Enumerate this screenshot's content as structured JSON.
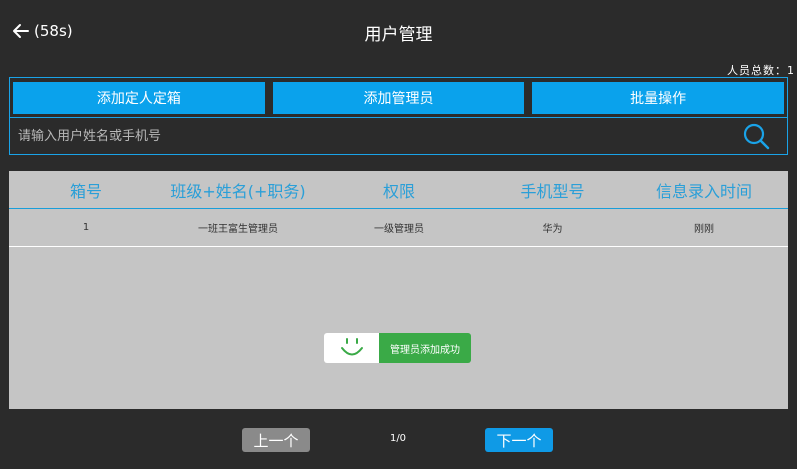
{
  "header": {
    "back_timer": "(58s)",
    "title": "用户管理",
    "total_count": "人员总数：1"
  },
  "actions": {
    "add_box_user": "添加定人定箱",
    "add_admin": "添加管理员",
    "batch_ops": "批量操作"
  },
  "search": {
    "placeholder": "请输入用户姓名或手机号",
    "value": ""
  },
  "table": {
    "columns": [
      "箱号",
      "班级+姓名(+职务)",
      "权限",
      "手机型号",
      "信息录入时间"
    ],
    "rows": [
      [
        "1",
        "一班王富生管理员",
        "一级管理员",
        "华为",
        "刚刚"
      ]
    ]
  },
  "toast": {
    "message": "管理员添加成功"
  },
  "pagination": {
    "prev_label": "上一个",
    "page_indicator": "1/0",
    "next_label": "下一个"
  },
  "colors": {
    "accent": "#0aa2ec",
    "success": "#3aaa47",
    "background": "#2b2b2b",
    "table_bg": "#c5c5c5"
  },
  "icons": {
    "back": "arrow-left-icon",
    "search": "search-icon",
    "toast": "smiley-icon"
  }
}
